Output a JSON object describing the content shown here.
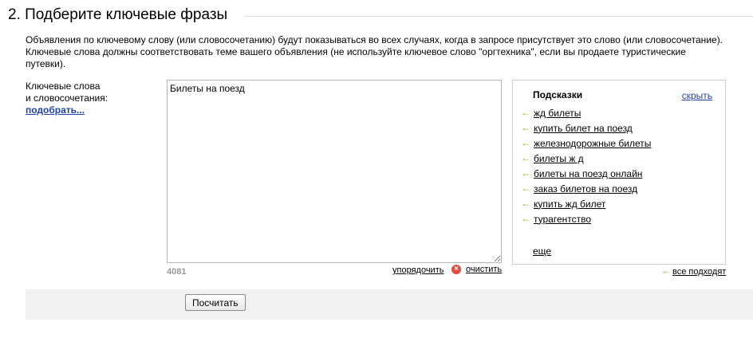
{
  "section": {
    "title": "2. Подберите ключевые фразы"
  },
  "intro": {
    "text": "Объявления по ключевому слову (или словосочетанию) будут показываться во всех случаях, когда в запросе присутствует это слово (или словосочетание). Ключевые слова должны соответствовать теме вашего объявления (не используйте ключевое слово \"оргтехника\", если вы продаете туристические путевки)."
  },
  "keywords": {
    "label_line1": "Ключевые слова",
    "label_line2": "и словосочетания:",
    "pick_link": "подобрать...",
    "value": "Билеты на поезд",
    "char_count": "4081",
    "sort_link": "упорядочить",
    "clear_link": "очистить"
  },
  "hints": {
    "title": "Подсказки",
    "hide_link": "скрыть",
    "items": [
      "жд билеты",
      "купить билет на поезд",
      "железнодорожные билеты",
      "билеты ж д",
      "билеты на поезд онлайн",
      "заказ билетов на поезд",
      "купить жд билет",
      "турагентство"
    ],
    "more_link": "еще",
    "all_fit_link": "все подходят"
  },
  "footer": {
    "calculate_button": "Посчитать"
  },
  "icons": {
    "add_arrow": "left-arrow-icon",
    "clear": "clear-icon"
  },
  "colors": {
    "link_blue": "#2244aa",
    "arrow_green": "#77bb22",
    "clear_red": "#e24a3f",
    "footer_bg": "#f1f1f1"
  }
}
